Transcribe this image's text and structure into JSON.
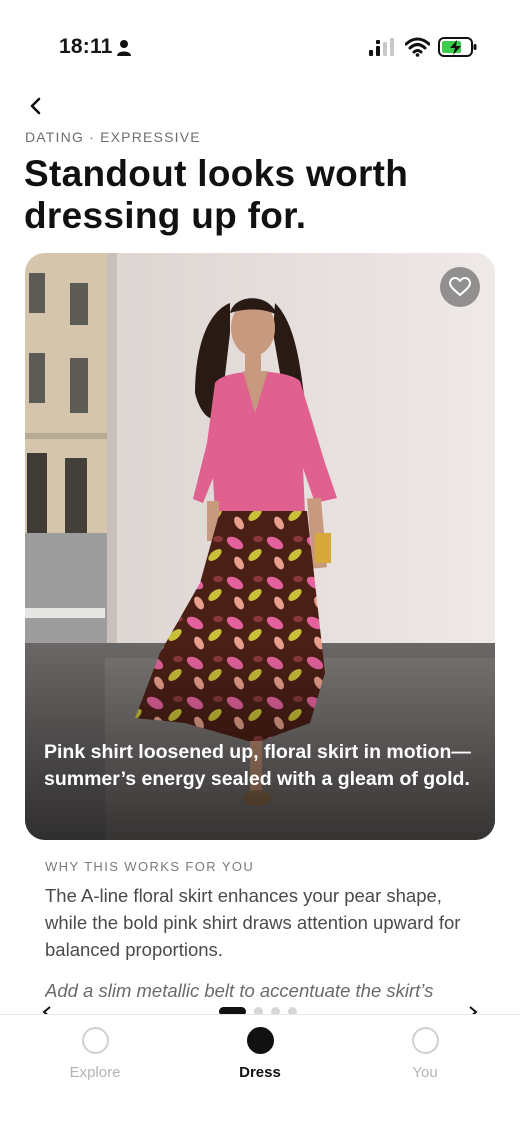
{
  "status_bar": {
    "time": "18:11",
    "icons": [
      "person-icon",
      "signal-icon",
      "wifi-icon",
      "battery-charging-icon"
    ]
  },
  "header": {
    "back_icon": "chevron-left-icon",
    "eyebrow": "DATING · EXPRESSIVE",
    "title": "Standout looks worth dressing up for."
  },
  "look": {
    "favorite_icon": "heart-icon",
    "caption": "Pink shirt loosened up, floral skirt in motion—summer’s energy sealed with a gleam of gold."
  },
  "why": {
    "heading": "WHY THIS WORKS FOR YOU",
    "body": "The A-line floral skirt enhances your pear shape, while the bold pink shirt draws attention upward for balanced proportions.",
    "tip": "Add a slim metallic belt to accentuate the skirt’s"
  },
  "carousel": {
    "dots": 4,
    "active_index": 0
  },
  "tabs": [
    {
      "label": "Explore",
      "active": false
    },
    {
      "label": "Dress",
      "active": true
    },
    {
      "label": "You",
      "active": false
    }
  ],
  "colors": {
    "accent": "#111111",
    "inactive": "#b4b4b4",
    "battery": "#3ccf4e"
  }
}
